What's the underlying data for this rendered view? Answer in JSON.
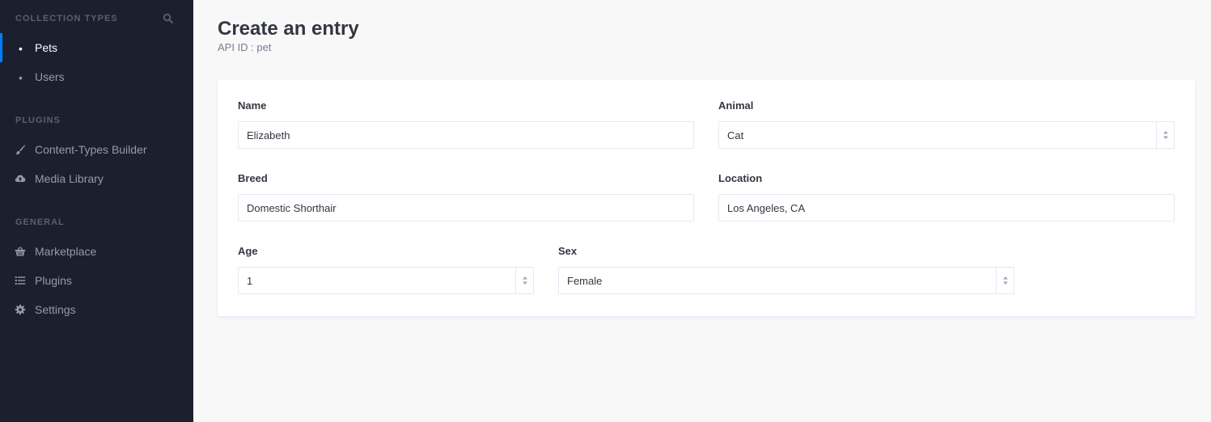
{
  "sidebar": {
    "collection_types_title": "COLLECTION TYPES",
    "collection_items": [
      {
        "label": "Pets",
        "active": true
      },
      {
        "label": "Users",
        "active": false
      }
    ],
    "plugins_title": "PLUGINS",
    "plugin_items": [
      {
        "label": "Content-Types Builder",
        "icon": "paintbrush-icon"
      },
      {
        "label": "Media Library",
        "icon": "cloud-upload-icon"
      }
    ],
    "general_title": "GENERAL",
    "general_items": [
      {
        "label": "Marketplace",
        "icon": "basket-icon"
      },
      {
        "label": "Plugins",
        "icon": "list-icon"
      },
      {
        "label": "Settings",
        "icon": "gear-icon"
      }
    ]
  },
  "header": {
    "title": "Create an entry",
    "subtitle": "API ID : pet"
  },
  "form": {
    "name": {
      "label": "Name",
      "value": "Elizabeth"
    },
    "animal": {
      "label": "Animal",
      "value": "Cat"
    },
    "breed": {
      "label": "Breed",
      "value": "Domestic Shorthair"
    },
    "location": {
      "label": "Location",
      "value": "Los Angeles, CA"
    },
    "age": {
      "label": "Age",
      "value": "1"
    },
    "sex": {
      "label": "Sex",
      "value": "Female"
    }
  },
  "colors": {
    "sidebar_bg": "#1c202e",
    "accent": "#007eff",
    "page_bg": "#f8f8f9"
  }
}
